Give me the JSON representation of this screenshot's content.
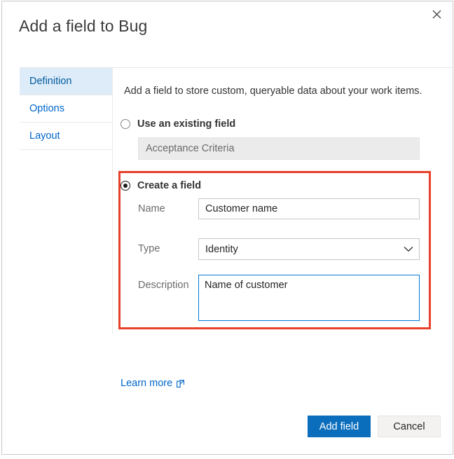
{
  "dialog": {
    "title": "Add a field to Bug",
    "close_icon": "close-icon"
  },
  "tabs": [
    {
      "label": "Definition",
      "selected": true
    },
    {
      "label": "Options",
      "selected": false
    },
    {
      "label": "Layout",
      "selected": false
    }
  ],
  "main": {
    "intro": "Add a field to store custom, queryable data about your work items.",
    "existing": {
      "radio_label": "Use an existing field",
      "selected": false,
      "field_value": "Acceptance Criteria"
    },
    "create": {
      "radio_label": "Create a field",
      "selected": true,
      "name_label": "Name",
      "name_value": "Customer name",
      "type_label": "Type",
      "type_value": "Identity",
      "type_chevron_icon": "chevron-down-icon",
      "description_label": "Description",
      "description_value": "Name of customer"
    },
    "learn_more": {
      "label": "Learn more",
      "icon": "external-link-icon"
    }
  },
  "footer": {
    "primary_label": "Add field",
    "secondary_label": "Cancel"
  },
  "colors": {
    "accent": "#0a6ebd",
    "link": "#0066cc",
    "highlight_box": "#e8402a",
    "tab_selected_bg": "#deecf9",
    "focus_border": "#0078d4"
  }
}
